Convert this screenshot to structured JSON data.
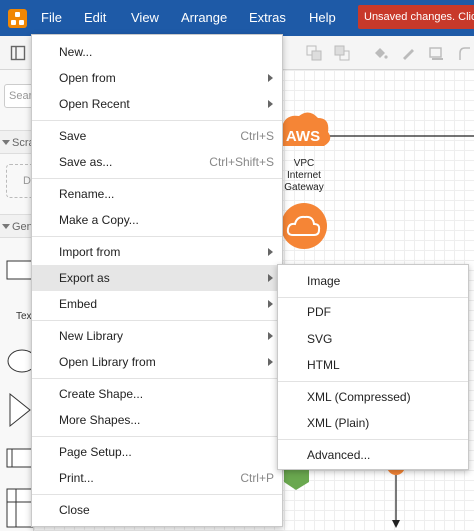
{
  "menubar": {
    "items": [
      "File",
      "Edit",
      "View",
      "Arrange",
      "Extras",
      "Help"
    ],
    "unsaved_notice": "Unsaved changes. Click here to save."
  },
  "sidebar": {
    "search_placeholder": "Search",
    "sections": [
      "Scratchpad",
      "General"
    ],
    "drop_hint": "Drag",
    "text_shape_label": "Text"
  },
  "canvas": {
    "aws_label": "AWS",
    "vpc_gateway_label": [
      "VPC",
      "Internet",
      "Gateway"
    ]
  },
  "file_menu": {
    "items": [
      {
        "label": "New...",
        "shortcut": ""
      },
      {
        "label": "Open from",
        "shortcut": "",
        "submenu": true
      },
      {
        "label": "Open Recent",
        "shortcut": "",
        "submenu": true
      },
      {
        "label": "Save",
        "shortcut": "Ctrl+S"
      },
      {
        "label": "Save as...",
        "shortcut": "Ctrl+Shift+S"
      },
      {
        "label": "Rename...",
        "shortcut": ""
      },
      {
        "label": "Make a Copy...",
        "shortcut": ""
      },
      {
        "label": "Import from",
        "shortcut": "",
        "submenu": true
      },
      {
        "label": "Export as",
        "shortcut": "",
        "submenu": true,
        "active": true
      },
      {
        "label": "Embed",
        "shortcut": "",
        "submenu": true
      },
      {
        "label": "New Library",
        "shortcut": "",
        "submenu": true
      },
      {
        "label": "Open Library from",
        "shortcut": "",
        "submenu": true
      },
      {
        "label": "Create Shape...",
        "shortcut": ""
      },
      {
        "label": "More Shapes...",
        "shortcut": ""
      },
      {
        "label": "Page Setup...",
        "shortcut": ""
      },
      {
        "label": "Print...",
        "shortcut": "Ctrl+P"
      },
      {
        "label": "Close",
        "shortcut": ""
      }
    ]
  },
  "export_submenu": {
    "items": [
      "Image",
      "PDF",
      "SVG",
      "HTML",
      "XML (Compressed)",
      "XML (Plain)",
      "Advanced..."
    ]
  },
  "colors": {
    "menubar": "#1e5aa7",
    "unsaved_notice": "#c8392a",
    "aws_orange": "#f58536",
    "menu_hover": "#e6e6e6"
  }
}
